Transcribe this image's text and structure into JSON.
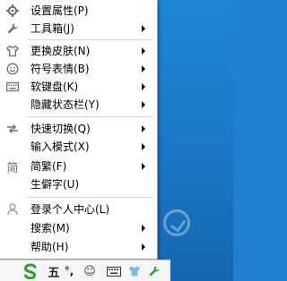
{
  "menu": {
    "items": [
      {
        "label": "设置属性(P)",
        "icon": "gear-icon",
        "submenu": false
      },
      {
        "label": "工具箱(J)",
        "icon": "wrench-icon",
        "submenu": true
      },
      {
        "label": "更换皮肤(N)",
        "icon": "shirt-icon",
        "submenu": true
      },
      {
        "label": "符号表情(B)",
        "icon": "smiley-icon",
        "submenu": true
      },
      {
        "label": "软键盘(K)",
        "icon": "keyboard-icon",
        "submenu": true
      },
      {
        "label": "隐藏状态栏(Y)",
        "icon": "",
        "submenu": true
      },
      {
        "label": "快速切换(Q)",
        "icon": "swap-arrows-icon",
        "submenu": true
      },
      {
        "label": "输入模式(X)",
        "icon": "",
        "submenu": true
      },
      {
        "label": "简繁(F)",
        "icon": "simplified-char-icon",
        "icon_glyph": "简",
        "submenu": true
      },
      {
        "label": "生僻字(U)",
        "icon": "",
        "submenu": false
      },
      {
        "label": "登录个人中心(L)",
        "icon": "person-icon",
        "submenu": false
      },
      {
        "label": "搜索(M)",
        "icon": "",
        "submenu": true
      },
      {
        "label": "帮助(H)",
        "icon": "",
        "submenu": true
      }
    ]
  },
  "statusbar": {
    "items": [
      {
        "name": "sogou-logo-icon",
        "text": "S"
      },
      {
        "name": "chinese-mode-indicator",
        "text": "五"
      },
      {
        "name": "punctuation-icon",
        "text": "°,"
      },
      {
        "name": "emoji-icon",
        "text": "☺"
      },
      {
        "name": "soft-keyboard-icon",
        "text": ""
      },
      {
        "name": "skin-icon",
        "text": ""
      },
      {
        "name": "tools-icon",
        "text": ""
      }
    ]
  },
  "colors": {
    "desktop": "#1f7fd0",
    "menu_bg": "#ffffff",
    "sogou_green": "#2aa02a",
    "arrow": "#000000"
  }
}
